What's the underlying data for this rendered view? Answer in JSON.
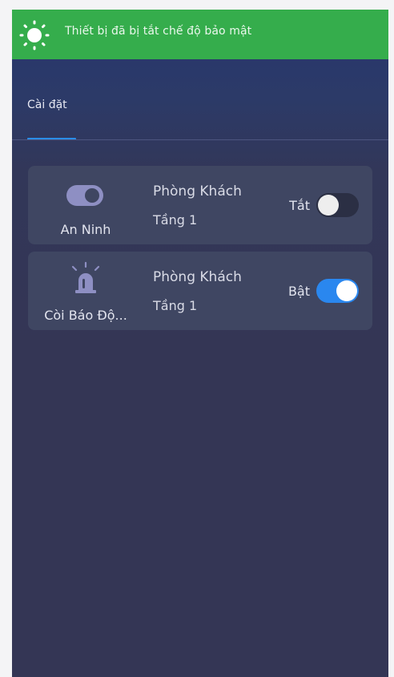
{
  "banner": {
    "message": "Thiết bị đã bị tắt chế độ bảo mật",
    "icon": "sun-icon",
    "color": "#35ad4c"
  },
  "tabs": [
    {
      "label": "Cài đặt",
      "active": true
    }
  ],
  "devices": [
    {
      "name": "An Ninh",
      "icon": "toggle-switch-icon",
      "room": "Phòng Khách",
      "floor": "Tầng 1",
      "state_label": "Tắt",
      "on": false
    },
    {
      "name": "Còi Báo Độ...",
      "icon": "siren-icon",
      "room": "Phòng Khách",
      "floor": "Tầng 1",
      "state_label": "Bật",
      "on": true
    }
  ],
  "colors": {
    "accent": "#2a87ef",
    "card": "#3f4662",
    "background": "#343655"
  }
}
